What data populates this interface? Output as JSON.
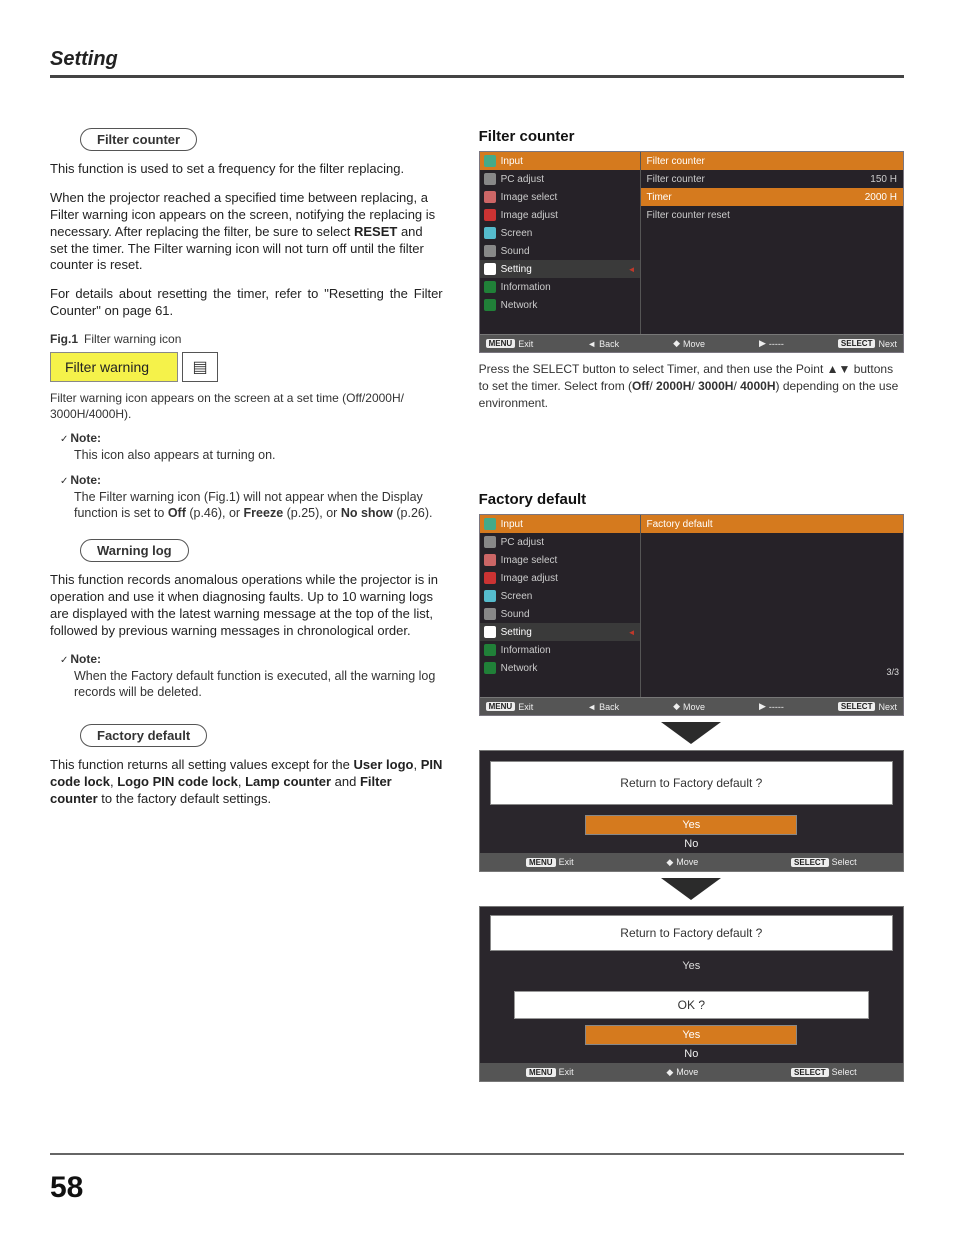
{
  "page": {
    "header": "Setting",
    "number": "58"
  },
  "left": {
    "pill_filter_counter": "Filter counter",
    "p1": "This function is used to set a frequency for the filter replacing.",
    "p2a": "When the projector reached a specified time between replacing, a Filter warning icon appears on the screen, notifying the replacing is necessary. After replacing the filter, be sure to select ",
    "p2_reset": "RESET",
    "p2b": " and set the timer. The Filter warning icon will not turn off until the filter counter is reset.",
    "p3": "For details about resetting the timer, refer to \"Resetting the Filter Counter\" on page 61.",
    "fig1_label": "Fig.1",
    "fig1_text": "Filter warning icon",
    "filter_warning_label": "Filter warning",
    "fw_caption": "Filter warning icon appears on the screen at a set time (Off/2000H/ 3000H/4000H).",
    "note1_label": "Note:",
    "note1_text": "This icon also appears at turning on.",
    "note2_label": "Note:",
    "note2_text_a": "The Filter warning icon (Fig.1) will not appear when the Display function is set to ",
    "note2_off": "Off",
    "note2_text_b": " (p.46), or ",
    "note2_freeze": "Freeze",
    "note2_text_c": " (p.25), or ",
    "note2_noshow": "No show",
    "note2_text_d": " (p.26).",
    "pill_warning_log": "Warning log",
    "wl_text": "This function records anomalous operations while the projector is in operation and use it when diagnosing faults. Up to 10 warning logs are displayed with the latest warning message at the top of the list, followed by previous warning messages in chronological order.",
    "note3_label": "Note:",
    "note3_text": "When the Factory default function is executed, all the warning log records will be deleted.",
    "pill_factory_default": "Factory default",
    "fd_text_a": "This function returns all setting values except for the ",
    "fd_b1": "User logo",
    "fd_s1": ", ",
    "fd_b2": "PIN code lock",
    "fd_s2": ", ",
    "fd_b3": "Logo PIN code lock",
    "fd_s3": ", ",
    "fd_b4": "Lamp counter",
    "fd_s4": " and ",
    "fd_b5": "Filter counter",
    "fd_text_b": " to the factory default settings."
  },
  "right": {
    "fc_heading": "Filter counter",
    "osd1": {
      "left_items": [
        "Input",
        "PC adjust",
        "Image select",
        "Image adjust",
        "Screen",
        "Sound",
        "Setting",
        "Information",
        "Network"
      ],
      "right_head": "Filter counter",
      "rows": [
        {
          "label": "Filter counter",
          "value": "150 H"
        },
        {
          "label": "Timer",
          "value": "2000 H",
          "sel": true
        },
        {
          "label": "Filter counter reset",
          "value": ""
        }
      ],
      "foot": {
        "menu": "MENU",
        "exit": "Exit",
        "back": "Back",
        "move": "Move",
        "dash": "-----",
        "select": "SELECT",
        "next": "Next"
      }
    },
    "fc_caption_a": "Press the SELECT button to select  Timer, and then use the Point ▲▼ buttons to set the timer. Select from (",
    "fc_caption_b": "Off",
    "fc_caption_c": "/ ",
    "fc_caption_d": "2000H",
    "fc_caption_e": "/ ",
    "fc_caption_f": "3000H",
    "fc_caption_g": "/ ",
    "fc_caption_h": "4000H",
    "fc_caption_i": ") depending on the use environment.",
    "fd_heading": "Factory default",
    "osd2": {
      "left_items": [
        "Input",
        "PC adjust",
        "Image select",
        "Image adjust",
        "Screen",
        "Sound",
        "Setting",
        "Information",
        "Network"
      ],
      "right_head": "Factory default",
      "page_ind": "3/3",
      "foot": {
        "menu": "MENU",
        "exit": "Exit",
        "back": "Back",
        "move": "Move",
        "dash": "-----",
        "select": "SELECT",
        "next": "Next"
      }
    },
    "confirm1": {
      "question": "Return to Factory default ?",
      "yes": "Yes",
      "no": "No",
      "foot": {
        "menu": "MENU",
        "exit": "Exit",
        "move": "Move",
        "select": "SELECT",
        "sel_label": "Select"
      }
    },
    "confirm2": {
      "question": "Return to Factory default ?",
      "answer": "Yes",
      "ok_q": "OK ?",
      "yes": "Yes",
      "no": "No",
      "foot": {
        "menu": "MENU",
        "exit": "Exit",
        "move": "Move",
        "select": "SELECT",
        "sel_label": "Select"
      }
    }
  }
}
